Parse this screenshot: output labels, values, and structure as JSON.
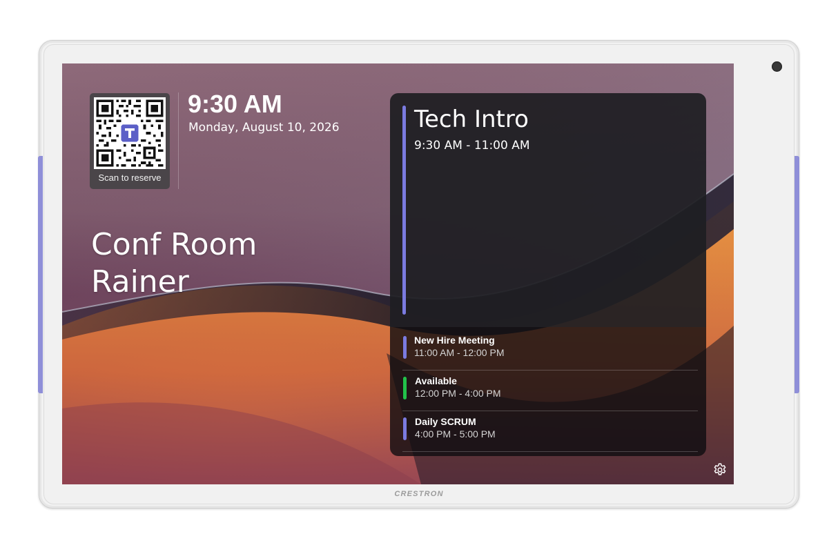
{
  "device": {
    "brand": "CRESTRON"
  },
  "header": {
    "qr_caption": "Scan to reserve",
    "time": "9:30 AM",
    "date": "Monday, August 10, 2026"
  },
  "room": {
    "name": "Conf Room Rainer"
  },
  "current_meeting": {
    "title": "Tech Intro",
    "time": "9:30 AM - 11:00 AM",
    "color": "#7b7be0"
  },
  "upcoming": [
    {
      "title": "New Hire Meeting",
      "time": "11:00 AM - 12:00 PM",
      "color": "#7b7be0"
    },
    {
      "title": "Available",
      "time": "12:00 PM - 4:00 PM",
      "color": "#22c24a"
    },
    {
      "title": "Daily SCRUM",
      "time": "4:00 PM - 5:00 PM",
      "color": "#7b7be0"
    }
  ],
  "icons": {
    "settings": "gear-icon",
    "qr": "qr-code-icon",
    "teams": "teams-logo-icon"
  },
  "colors": {
    "accent": "#8f8fd8",
    "available": "#22c24a"
  }
}
